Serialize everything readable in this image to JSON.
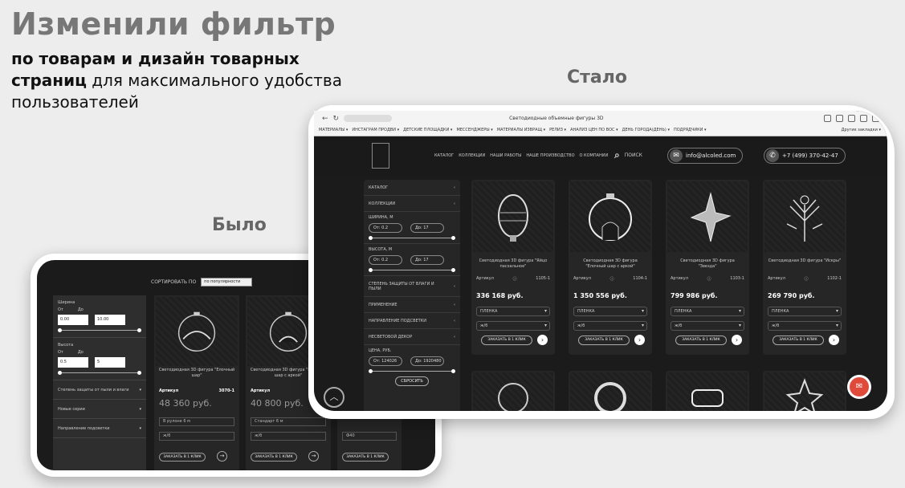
{
  "header": {
    "title": "Изменили фильтр",
    "sub_bold_1": "по товарам и дизайн товарных",
    "sub_bold_2": "страниц",
    "sub_rest": " для максимального удобства пользователей"
  },
  "labels": {
    "after": "Стало",
    "before": "Было"
  },
  "new_screen": {
    "tab_title": "Светодиодные объемные фигуры 3D",
    "bookmarks": [
      "МАТЕРИАЛЫ ▾",
      "ИНСТАГРАМ ПРОДВИ ▾",
      "ДЕТСКИЕ ПЛОЩАДКИ ▾",
      "МЕССЕНДЖЕРЫ ▾",
      "МАТЕРИАЛЫ ИЗВРАЩ ▾",
      "РЕЛИЗ ▾",
      "АНАЛИЗ ЦЕН ПО ВОС ▾",
      "ДЕНЬ ГОРОДА(ДЕНЬ) ▾",
      "ПОДРЯДЧИКИ ▾"
    ],
    "bookmark_right": "Другие закладки ▾",
    "nav": [
      "КАТАЛОГ",
      "КОЛЛЕКЦИИ",
      "НАШИ РАБОТЫ",
      "НАШЕ ПРОИЗВОДСТВО",
      "О КОМПАНИИ"
    ],
    "search_label": "ПОИСК",
    "email": "info@alcoled.com",
    "phone": "+7 (499) 370-42-47",
    "sidebar": {
      "catalog": "КАТАЛОГ",
      "collections": "КОЛЛЕКЦИИ",
      "width_label": "ШИРИНА, М",
      "width_from": "От: 0.2",
      "width_to": "До: 17",
      "height_label": "ВЫСОТА, М",
      "height_from": "От: 0.2",
      "height_to": "До: 17",
      "protection": "СТЕПЕНЬ ЗАЩИТЫ ОТ ВЛАГИ И ПЫЛИ",
      "filter1": "ПРИМЕНЕНИЕ",
      "filter2": "НАПРАВЛЕНИЕ ПОДСВЕТКИ",
      "filter3": "НЕСВЕТОВОЙ ДЕКОР",
      "price_label": "ЦЕНА, РУБ.",
      "price_from": "От: 124026",
      "price_to": "До: 1920480",
      "reset": "СБРОСИТЬ"
    },
    "cards": [
      {
        "name": "Светодиодная 3D фигура \"Яйцо пасхальное\"",
        "article_label": "Артикул",
        "article": "1105-1",
        "price": "336 168 руб.",
        "opt1": "ПЛЕНКА",
        "opt2": "ж/б",
        "btn": "ЗАКАЗАТЬ В 1 КЛИК"
      },
      {
        "name": "Светодиодная 3D фигура \"Елочный шар с аркой\"",
        "article_label": "Артикул",
        "article": "1104-1",
        "price": "1 350 556 руб.",
        "opt1": "ПЛЕНКА",
        "opt2": "ж/б",
        "btn": "ЗАКАЗАТЬ В 1 КЛИК"
      },
      {
        "name": "Светодиодная 3D фигура \"Звезда\"",
        "article_label": "Артикул",
        "article": "1103-1",
        "price": "799 986 руб.",
        "opt1": "ПЛЕНКА",
        "opt2": "ж/б",
        "btn": "ЗАКАЗАТЬ В 1 КЛИК"
      },
      {
        "name": "Светодиодная 3D фигура \"Искры\"",
        "article_label": "Артикул",
        "article": "1102-1",
        "price": "269 790 руб.",
        "opt1": "ПЛЕНКА",
        "opt2": "ж/б",
        "btn": "ЗАКАЗАТЬ В 1 КЛИК"
      }
    ]
  },
  "old_screen": {
    "sort_label": "СОРТИРОВАТЬ ПО",
    "sort_value": "по популярности",
    "width_label": "Ширина",
    "from": "От",
    "to": "До",
    "width_from": "0.00",
    "width_to": "10.00",
    "height_label": "Высота",
    "height_from": "0.5",
    "height_to": "5",
    "filter1": "Степень защиты от пыли и влаги",
    "filter2": "Новые серии",
    "filter3": "Направление подсветки",
    "cards": [
      {
        "name": "Светодиодная 3D фигура \"Елочный шар\"",
        "article_label": "Артикул",
        "article": "3070-1",
        "price": "48 360 руб.",
        "opt1": "В рулоне 6 м",
        "opt2": "ж/б",
        "btn": "ЗАКАЗАТЬ В 1 КЛИК"
      },
      {
        "name": "Светодиодная 3D фигура \"Елочный шар с аркой\"",
        "article_label": "Артикул",
        "article": "3071-1",
        "price": "40 800 руб.",
        "opt1": "Стандарт 6 м",
        "opt2": "ж/б",
        "btn": "ЗАКАЗАТЬ В 1 КЛИК"
      },
      {
        "name": "",
        "article_label": "",
        "article": "",
        "price": "",
        "opt1": "",
        "opt2": "Ф40",
        "btn": "ЗАКАЗАТЬ В 1 КЛИК"
      }
    ]
  },
  "colors": {
    "bg": "#ededed",
    "screen": "#1b1b1b",
    "card": "#262626",
    "chat": "#e04a3a"
  }
}
